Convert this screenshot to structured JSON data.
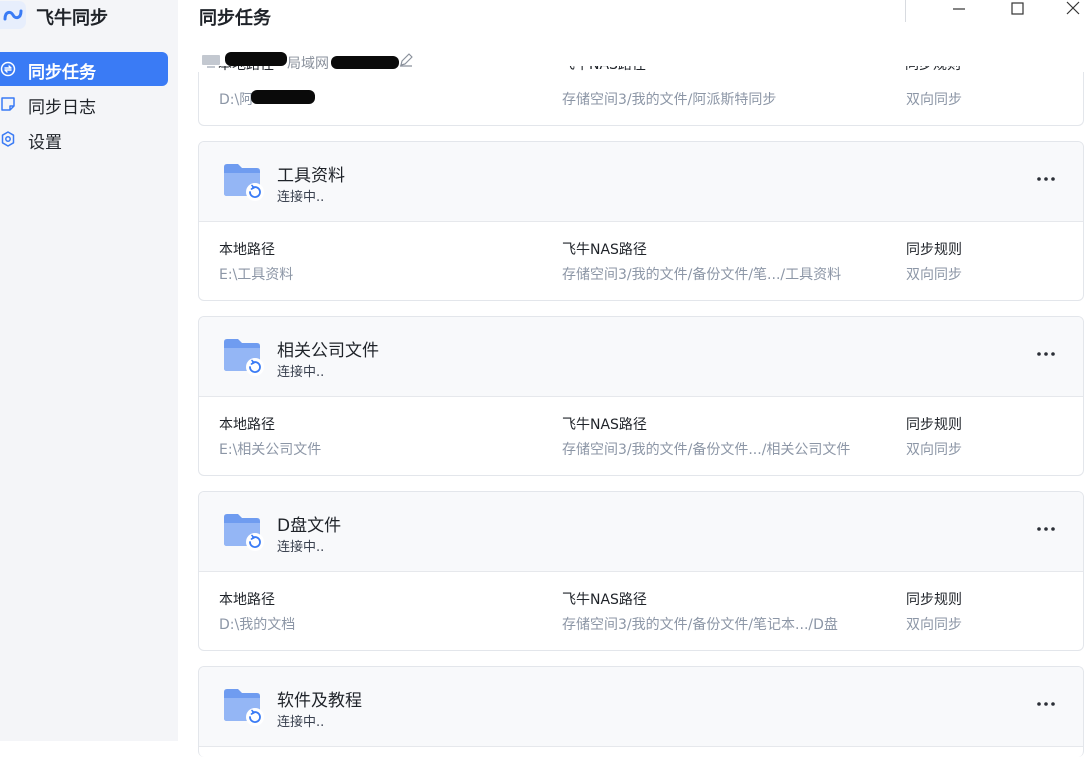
{
  "app": {
    "name": "飞牛同步"
  },
  "sidebar": {
    "items": [
      {
        "label": "同步任务",
        "active": true
      },
      {
        "label": "同步日志",
        "active": false
      },
      {
        "label": "设置",
        "active": false
      }
    ]
  },
  "header": {
    "title": "同步任务"
  },
  "device": {
    "network_label": "局域网"
  },
  "columns": {
    "local": "本地路径",
    "nas": "飞牛NAS路径",
    "rule": "同步规则"
  },
  "partial_task": {
    "local_path": "D:\\阿",
    "nas_path": "存储空间3/我的文件/阿派斯特同步",
    "rule": "双向同步"
  },
  "tasks": [
    {
      "name": "工具资料",
      "status": "连接中..",
      "local_path": "E:\\工具资料",
      "nas_path": "存储空间3/我的文件/备份文件/笔.../工具资料",
      "rule": "双向同步"
    },
    {
      "name": "相关公司文件",
      "status": "连接中..",
      "local_path": "E:\\相关公司文件",
      "nas_path": "存储空间3/我的文件/备份文件.../相关公司文件",
      "rule": "双向同步"
    },
    {
      "name": "D盘文件",
      "status": "连接中..",
      "local_path": "D:\\我的文档",
      "nas_path": "存储空间3/我的文件/备份文件/笔记本.../D盘",
      "rule": "双向同步"
    },
    {
      "name": "软件及教程",
      "status": "连接中..",
      "local_path": "",
      "nas_path": "",
      "rule": ""
    }
  ],
  "colors": {
    "accent": "#3a7bf5",
    "folder": "#6f9cf0",
    "sidebar_bg": "#f4f5f8"
  }
}
